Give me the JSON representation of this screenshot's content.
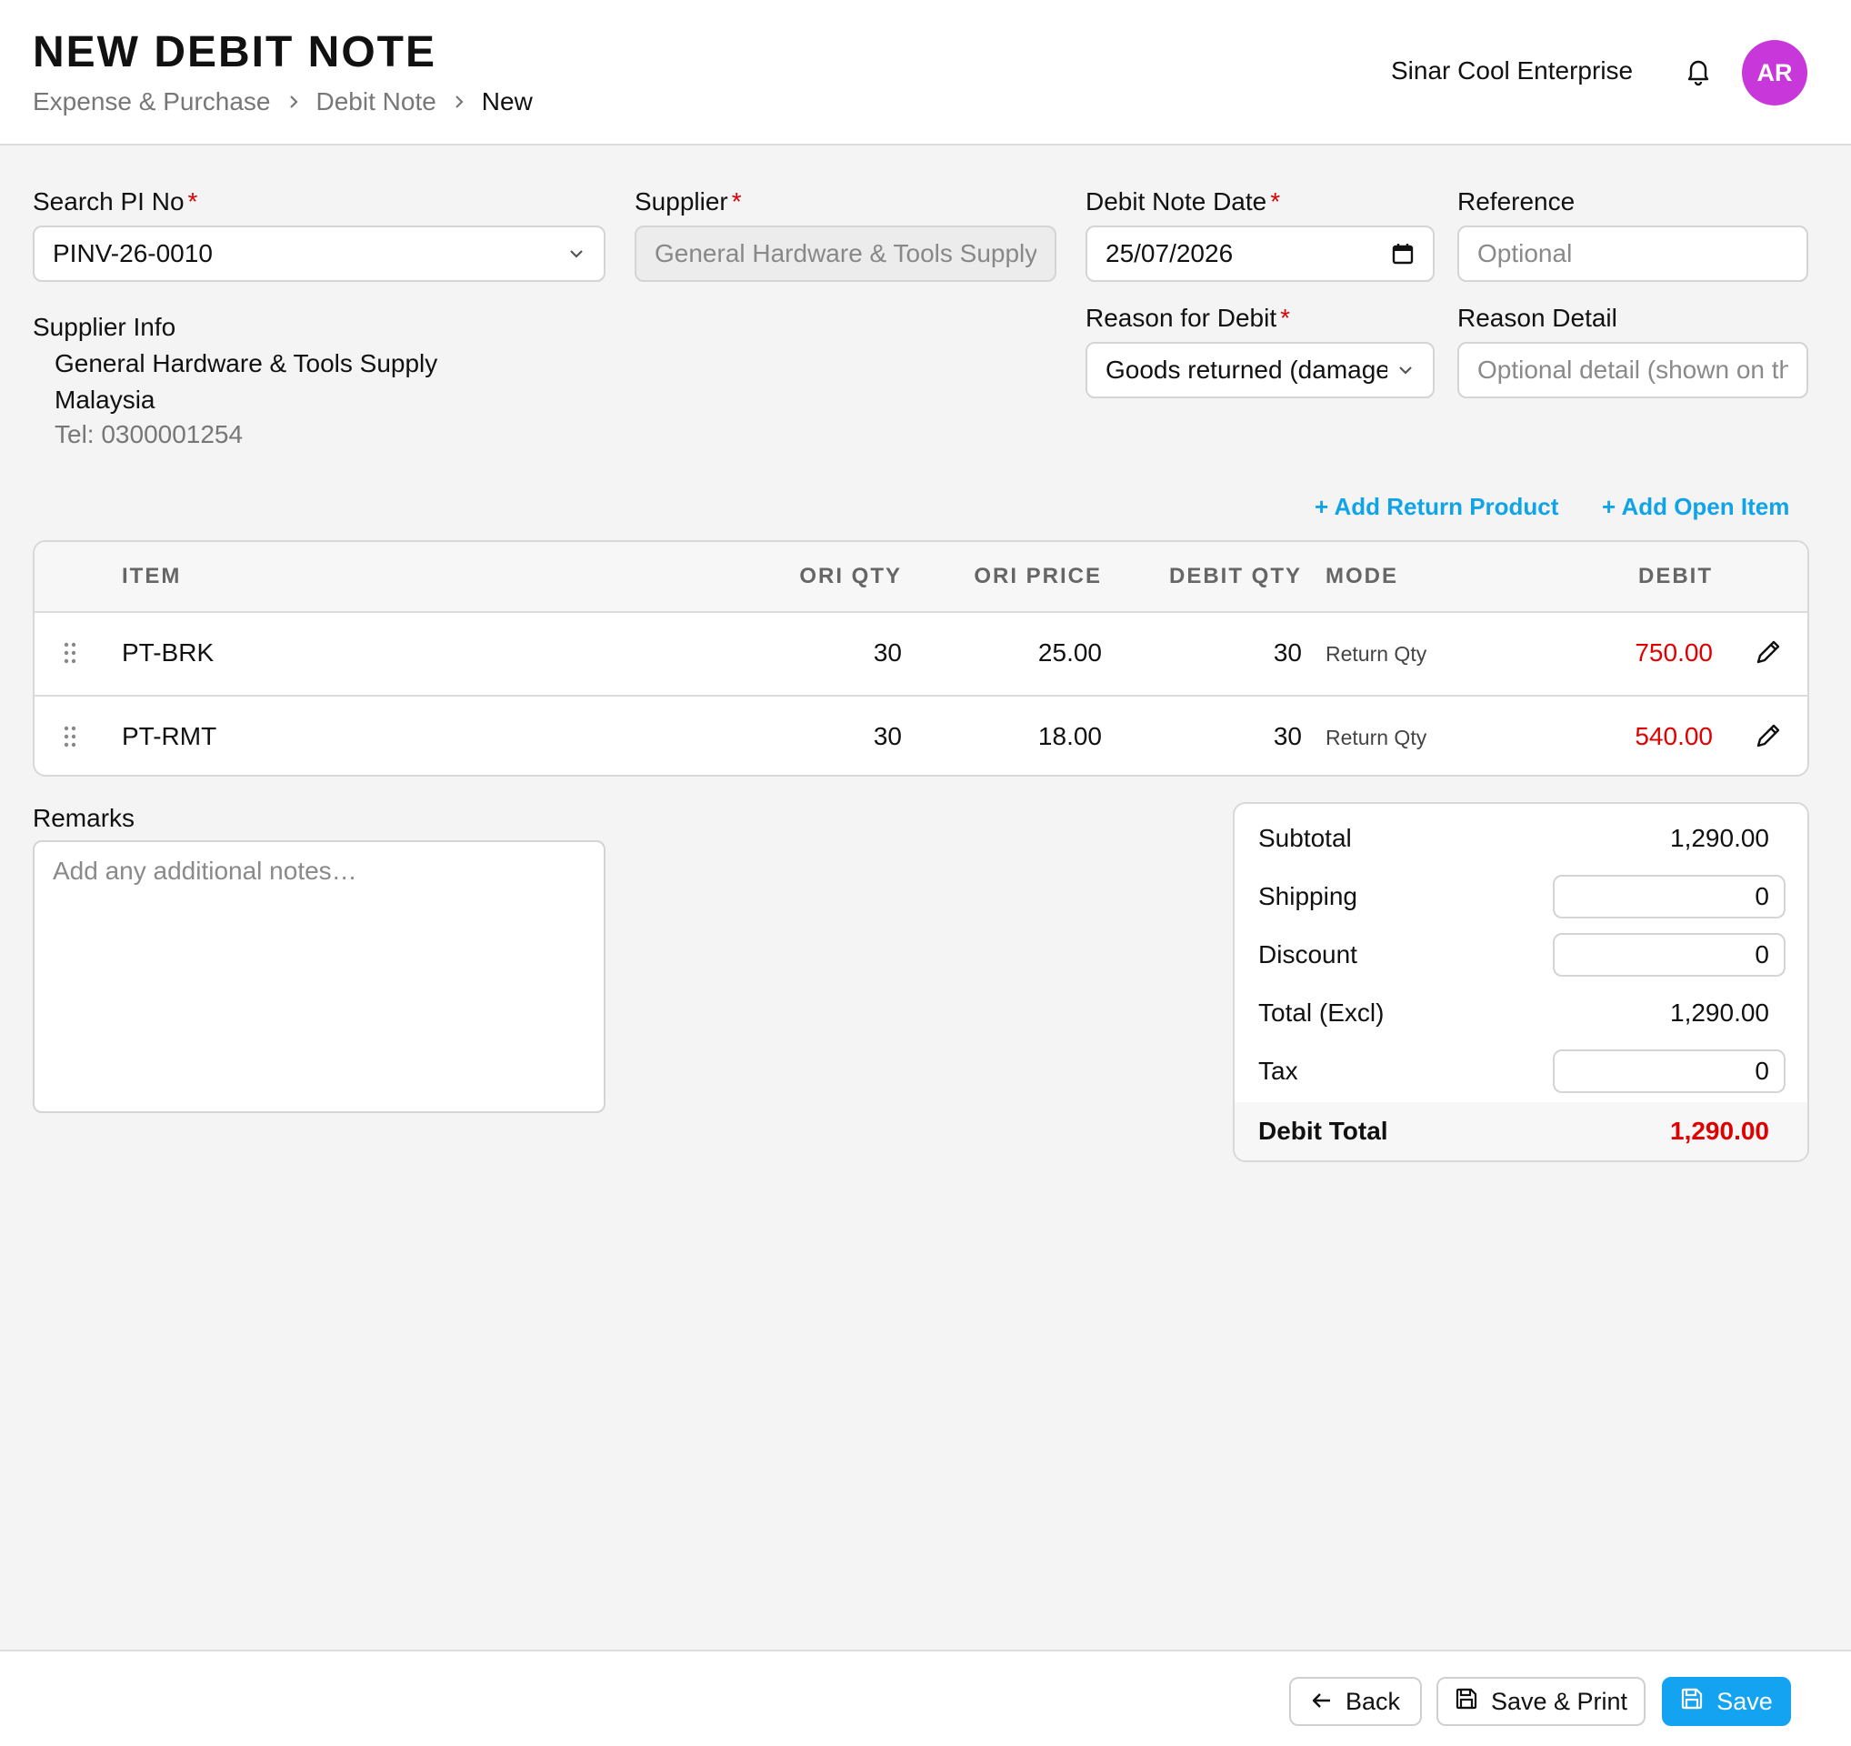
{
  "header": {
    "title": "NEW DEBIT NOTE",
    "breadcrumb": [
      "Expense & Purchase",
      "Debit Note",
      "New"
    ],
    "company": "Sinar Cool Enterprise",
    "avatar_initials": "AR",
    "avatar_color": "#c837d9"
  },
  "form": {
    "pi_label": "Search PI No",
    "pi_value": "PINV-26-0010",
    "supplier_label": "Supplier",
    "supplier_value": "General Hardware & Tools Supply",
    "date_label": "Debit Note Date",
    "date_value": "25/07/2026",
    "reference_label": "Reference",
    "reference_placeholder": "Optional",
    "reason_label": "Reason for Debit",
    "reason_value": "Goods returned (damaged)",
    "reason_detail_label": "Reason Detail",
    "reason_detail_placeholder": "Optional detail (shown on the document)",
    "required_mark": "*"
  },
  "supplier_info": {
    "label": "Supplier Info",
    "name": "General Hardware & Tools Supply",
    "country": "Malaysia",
    "tel": "Tel: 0300001254"
  },
  "actions": {
    "add_return": "+ Add Return Product",
    "add_open": "+ Add Open Item"
  },
  "table": {
    "columns": {
      "item": "ITEM",
      "ori_qty": "ORI QTY",
      "ori_price": "ORI PRICE",
      "debit_qty": "DEBIT QTY",
      "mode": "MODE",
      "debit": "DEBIT"
    },
    "rows": [
      {
        "item": "PT-BRK",
        "ori_qty": "30",
        "ori_price": "25.00",
        "debit_qty": "30",
        "mode": "Return Qty",
        "debit": "750.00"
      },
      {
        "item": "PT-RMT",
        "ori_qty": "30",
        "ori_price": "18.00",
        "debit_qty": "30",
        "mode": "Return Qty",
        "debit": "540.00"
      }
    ]
  },
  "remarks": {
    "label": "Remarks",
    "placeholder": "Add any additional notes…"
  },
  "summary": {
    "subtotal_label": "Subtotal",
    "subtotal": "1,290.00",
    "shipping_label": "Shipping",
    "shipping": "0",
    "discount_label": "Discount",
    "discount": "0",
    "total_excl_label": "Total (Excl)",
    "total_excl": "1,290.00",
    "tax_label": "Tax",
    "tax": "0",
    "debit_total_label": "Debit Total",
    "debit_total": "1,290.00"
  },
  "footer": {
    "back": "Back",
    "save_print": "Save & Print",
    "save": "Save"
  },
  "colors": {
    "accent": "#14a3f0",
    "link": "#11a3e8",
    "debit_red": "#e00000"
  }
}
